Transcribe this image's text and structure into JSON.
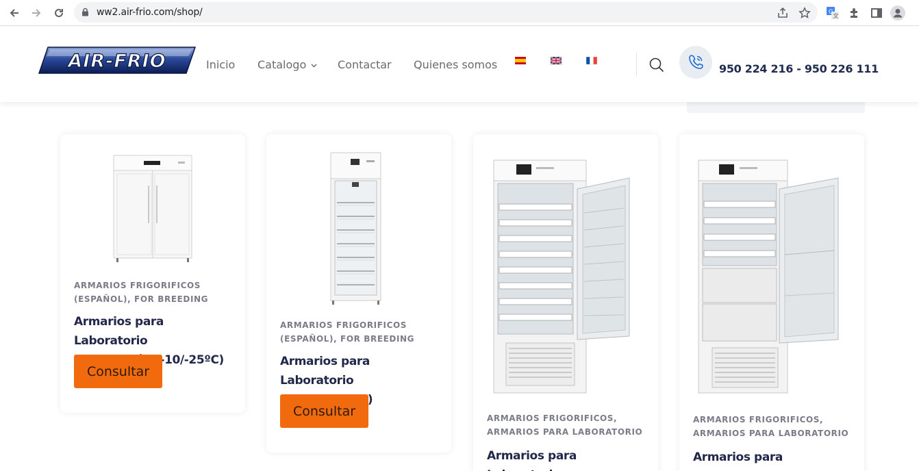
{
  "browser": {
    "url": "ww2.air-frio.com/shop/"
  },
  "header": {
    "logo_text": "AIR-FRIO",
    "menu": {
      "inicio": "Inicio",
      "catalogo": "Catalogo",
      "contactar": "Contactar",
      "quienes": "Quienes somos"
    },
    "languages": [
      "es",
      "en",
      "fr"
    ],
    "phone": "950 224 216 - 950 226 111"
  },
  "products": [
    {
      "category_line1": "ARMARIOS FRIGORIFICOS",
      "category_line2": "(ESPAÑOL), FOR BREEDING",
      "title_line1": "Armarios para Laboratorio",
      "title_line2": "Congelación (-10/-25ºC)",
      "button": "Consultar"
    },
    {
      "category_line1": "ARMARIOS FRIGORIFICOS",
      "category_line2": "(ESPAÑOL), FOR BREEDING",
      "title_line1": "Armarios para Laboratorio",
      "title_line2": "ECO (+2/+8ºC)",
      "button": "Consultar"
    },
    {
      "category_line1": "ARMARIOS FRIGORIFICOS,",
      "category_line2": "ARMARIOS PARA LABORATORIO",
      "title_line1": "Armarios para Laboratorio"
    },
    {
      "category_line1": "ARMARIOS FRIGORIFICOS,",
      "category_line2": "ARMARIOS PARA LABORATORIO",
      "title_line1": "Armarios para Laboratorio"
    }
  ],
  "colors": {
    "accent": "#f26a0e",
    "title": "#22284a",
    "category": "#7a7c88"
  }
}
